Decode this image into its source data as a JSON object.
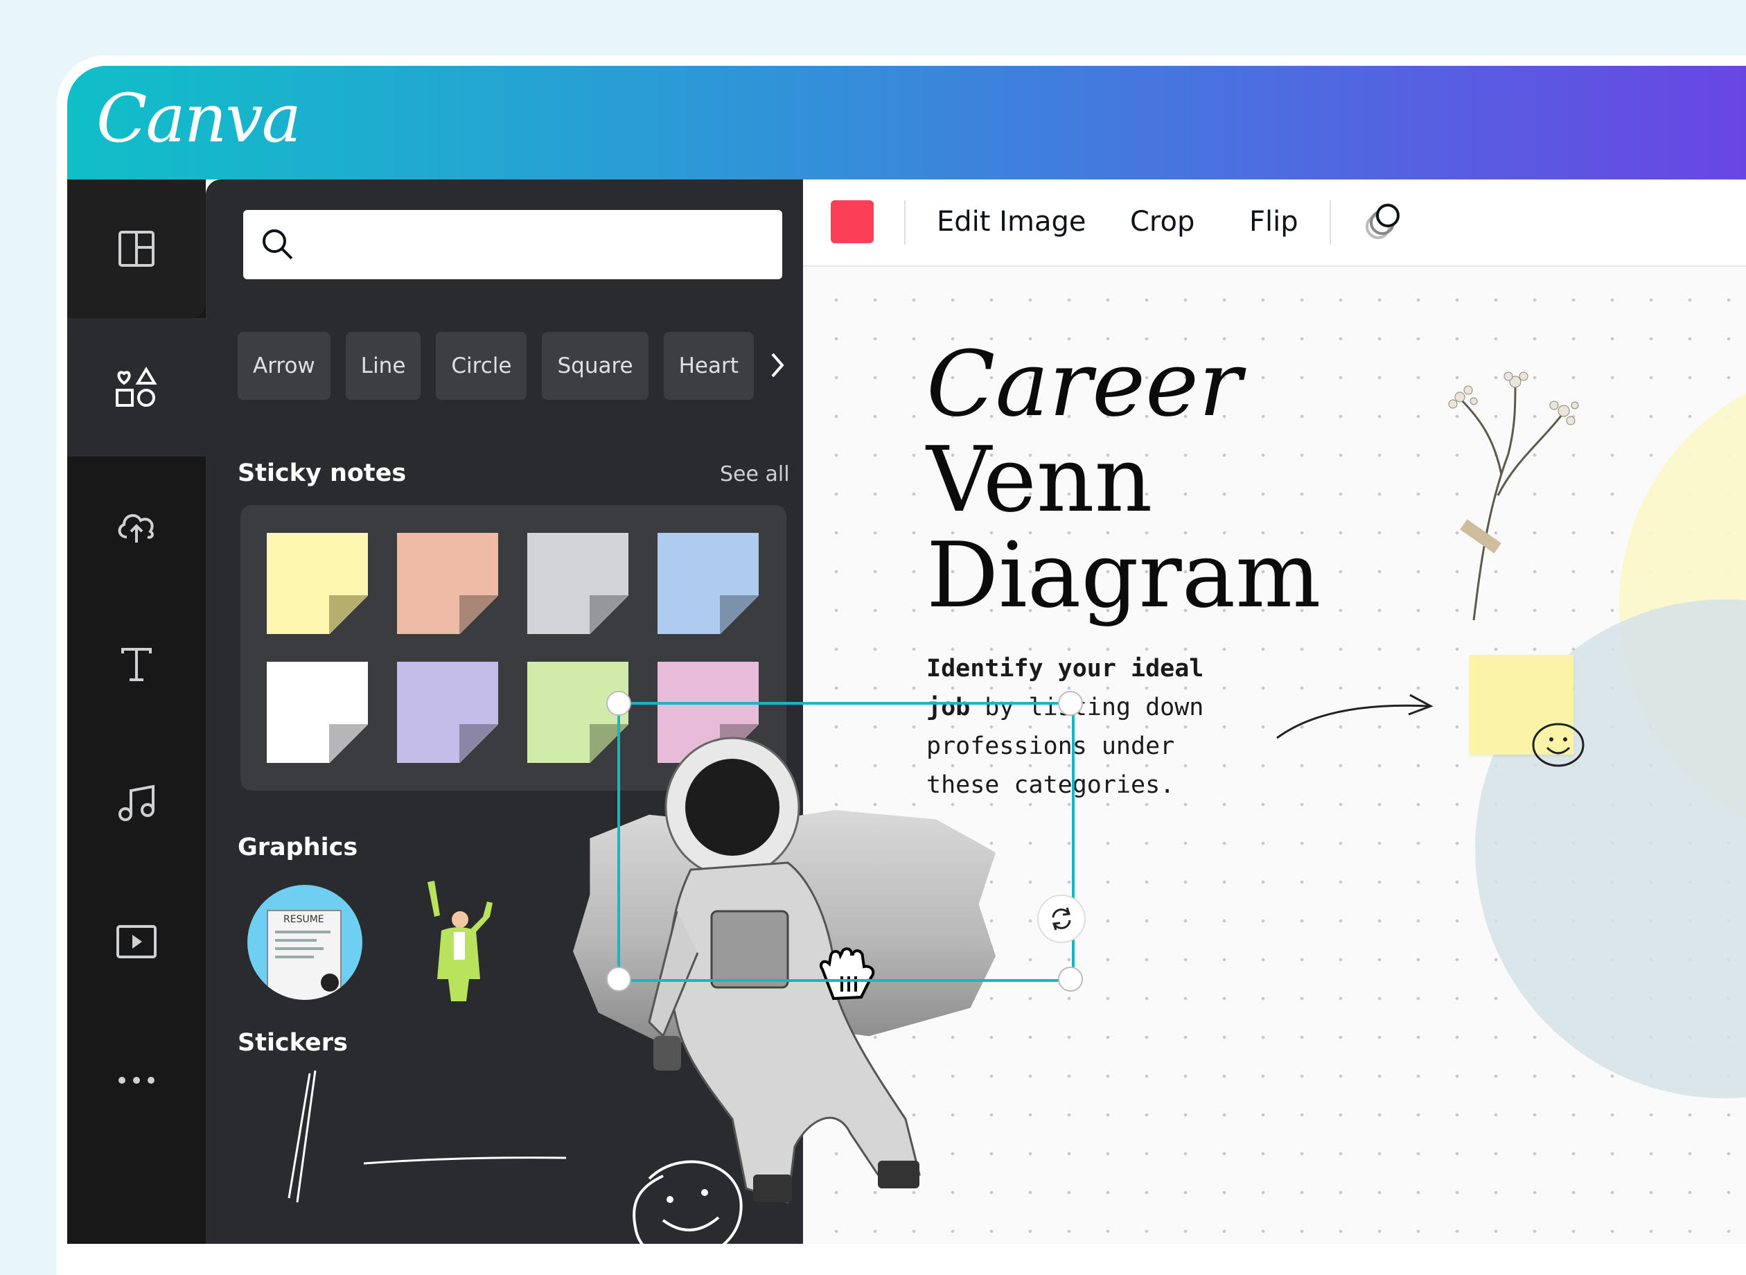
{
  "app": {
    "logo": "Canva"
  },
  "rail": {
    "items": [
      {
        "icon": "templates-icon"
      },
      {
        "icon": "elements-icon",
        "active": true
      },
      {
        "icon": "upload-cloud-icon"
      },
      {
        "icon": "text-icon"
      },
      {
        "icon": "music-icon"
      },
      {
        "icon": "video-icon"
      },
      {
        "icon": "more-icon"
      }
    ]
  },
  "panel": {
    "search": {
      "placeholder": ""
    },
    "chips": [
      "Arrow",
      "Line",
      "Circle",
      "Square",
      "Heart"
    ],
    "sticky_notes": {
      "heading": "Sticky notes",
      "see_all": "See all",
      "colors": [
        "#fcf6ae",
        "#eebba6",
        "#d2d4d9",
        "#aecbf0",
        "#ffffff",
        "#c4bde9",
        "#d1ecaa",
        "#e8bcd8"
      ]
    },
    "graphics": {
      "heading": "Graphics",
      "resume_label": "RESUME"
    },
    "stickers": {
      "heading": "Stickers"
    }
  },
  "toolbar": {
    "color": "#fc3f56",
    "edit_image": "Edit Image",
    "crop": "Crop",
    "flip": "Flip"
  },
  "canvas": {
    "title_line1": "Career",
    "title_line2": "Venn",
    "title_line3": "Diagram",
    "desc_bold": "Identify your ideal job",
    "desc_rest": " by listing down professions under these categories."
  }
}
